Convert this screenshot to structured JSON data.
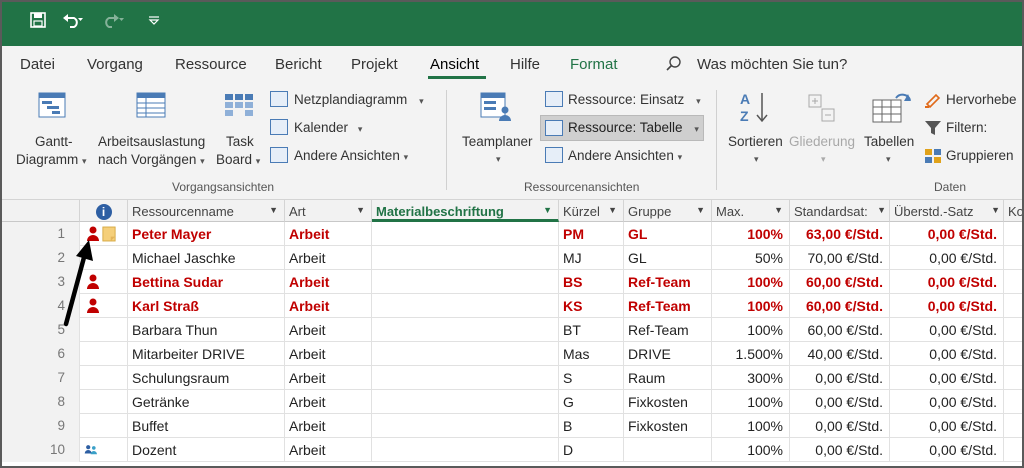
{
  "quick_access": {
    "save_icon": "save-icon",
    "undo_icon": "undo-icon",
    "redo_icon": "redo-icon",
    "customize_icon": "customize-icon"
  },
  "tabs": [
    {
      "label": "Datei"
    },
    {
      "label": "Vorgang"
    },
    {
      "label": "Ressource"
    },
    {
      "label": "Bericht"
    },
    {
      "label": "Projekt"
    },
    {
      "label": "Ansicht"
    },
    {
      "label": "Hilfe"
    },
    {
      "label": "Format"
    }
  ],
  "tell_me": "Was möchten Sie tun?",
  "ribbon": {
    "gantt": {
      "line1": "Gantt-",
      "line2": "Diagramm"
    },
    "arbeitsauslastung": {
      "line1": "Arbeitsauslastung",
      "line2": "nach Vorgängen"
    },
    "task_board": {
      "line1": "Task",
      "line2": "Board"
    },
    "netzplan": "Netzplandiagramm",
    "kalender": "Kalender",
    "andere_ansichten_1": "Andere Ansichten",
    "group1": "Vorgangsansichten",
    "teamplaner": "Teamplaner",
    "ressource_einsatz": "Ressource: Einsatz",
    "ressource_tabelle": "Ressource: Tabelle",
    "andere_ansichten_2": "Andere Ansichten",
    "group2": "Ressourcenansichten",
    "sortieren": "Sortieren",
    "gliederung": "Gliederung",
    "tabellen": "Tabellen",
    "hervorheben": "Hervorhebe",
    "filtern": "Filtern:",
    "gruppieren": "Gruppieren",
    "group3": "Daten"
  },
  "columns": {
    "info": "i",
    "name": "Ressourcenname",
    "art": "Art",
    "material": "Materialbeschriftung",
    "kuerzel": "Kürzel",
    "gruppe": "Gruppe",
    "max": "Max.",
    "standard": "Standardsat:",
    "ueberstd": "Überstd.-Satz",
    "extra": "Ko"
  },
  "rows": [
    {
      "n": "1",
      "name": "Peter Mayer",
      "art": "Arbeit",
      "kz": "PM",
      "gr": "GL",
      "max": "100%",
      "std": "63,00 €/Std.",
      "ue": "0,00 €/Std.",
      "over": true,
      "icon": "person-note"
    },
    {
      "n": "2",
      "name": "Michael Jaschke",
      "art": "Arbeit",
      "kz": "MJ",
      "gr": "GL",
      "max": "50%",
      "std": "70,00 €/Std.",
      "ue": "0,00 €/Std.",
      "over": false,
      "icon": ""
    },
    {
      "n": "3",
      "name": "Bettina Sudar",
      "art": "Arbeit",
      "kz": "BS",
      "gr": "Ref-Team",
      "max": "100%",
      "std": "60,00 €/Std.",
      "ue": "0,00 €/Std.",
      "over": true,
      "icon": "person"
    },
    {
      "n": "4",
      "name": "Karl Straß",
      "art": "Arbeit",
      "kz": "KS",
      "gr": "Ref-Team",
      "max": "100%",
      "std": "60,00 €/Std.",
      "ue": "0,00 €/Std.",
      "over": true,
      "icon": "person"
    },
    {
      "n": "5",
      "name": "Barbara Thun",
      "art": "Arbeit",
      "kz": "BT",
      "gr": "Ref-Team",
      "max": "100%",
      "std": "60,00 €/Std.",
      "ue": "0,00 €/Std.",
      "over": false,
      "icon": ""
    },
    {
      "n": "6",
      "name": "Mitarbeiter DRIVE",
      "art": "Arbeit",
      "kz": "Mas",
      "gr": "DRIVE",
      "max": "1.500%",
      "std": "40,00 €/Std.",
      "ue": "0,00 €/Std.",
      "over": false,
      "icon": ""
    },
    {
      "n": "7",
      "name": "Schulungsraum",
      "art": "Arbeit",
      "kz": "S",
      "gr": "Raum",
      "max": "300%",
      "std": "0,00 €/Std.",
      "ue": "0,00 €/Std.",
      "over": false,
      "icon": ""
    },
    {
      "n": "8",
      "name": "Getränke",
      "art": "Arbeit",
      "kz": "G",
      "gr": "Fixkosten",
      "max": "100%",
      "std": "0,00 €/Std.",
      "ue": "0,00 €/Std.",
      "over": false,
      "icon": ""
    },
    {
      "n": "9",
      "name": "Buffet",
      "art": "Arbeit",
      "kz": "B",
      "gr": "Fixkosten",
      "max": "100%",
      "std": "0,00 €/Std.",
      "ue": "0,00 €/Std.",
      "over": false,
      "icon": ""
    },
    {
      "n": "10",
      "name": "Dozent",
      "art": "Arbeit",
      "kz": "D",
      "gr": "",
      "max": "100%",
      "std": "0,00 €/Std.",
      "ue": "0,00 €/Std.",
      "over": false,
      "icon": "team"
    }
  ],
  "colors": {
    "accent": "#217346",
    "overallocated": "#c00000"
  }
}
